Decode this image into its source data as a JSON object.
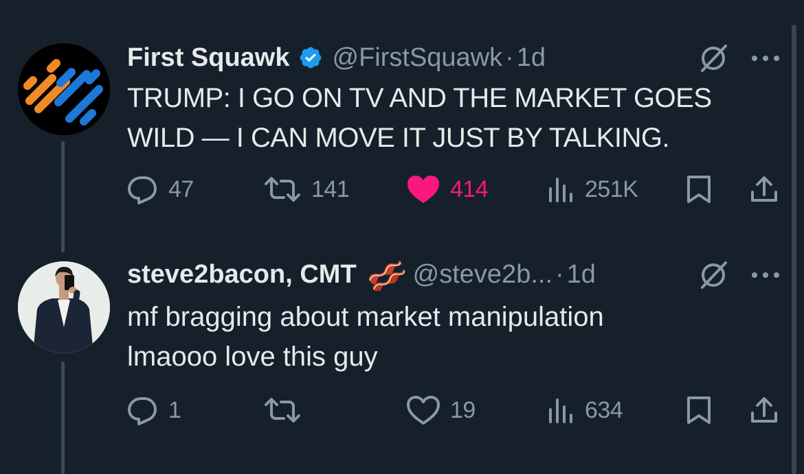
{
  "colors": {
    "background": "#15202b",
    "text_primary": "#e7e9ea",
    "text_secondary": "#8b98a5",
    "like_active": "#f91880",
    "verified_blue": "#1d9bf0"
  },
  "tweets": [
    {
      "display_name": "First Squawk",
      "verified": true,
      "handle": "@FirstSquawk",
      "separator": "·",
      "time": "1d",
      "text": "TRUMP: I GO ON TV AND THE MARKET GOES\nWILD — I CAN MOVE IT JUST BY TALKING.",
      "actions": {
        "replies": "47",
        "reposts": "141",
        "likes": "414",
        "liked": true,
        "views": "251K"
      },
      "icons": [
        "reply-icon",
        "repost-icon",
        "like-icon",
        "views-icon",
        "bookmark-icon",
        "share-icon",
        "grok-icon",
        "more-icon"
      ]
    },
    {
      "display_name": "steve2bacon, CMT",
      "name_emoji": "bacon",
      "handle": "@steve2b...",
      "separator": "·",
      "time": "1d",
      "text": "mf bragging about market manipulation\nlmaooo love this guy",
      "actions": {
        "replies": "1",
        "reposts": "",
        "likes": "19",
        "liked": false,
        "views": "634"
      },
      "icons": [
        "reply-icon",
        "repost-icon",
        "like-icon",
        "views-icon",
        "bookmark-icon",
        "share-icon",
        "grok-icon",
        "more-icon"
      ]
    }
  ]
}
